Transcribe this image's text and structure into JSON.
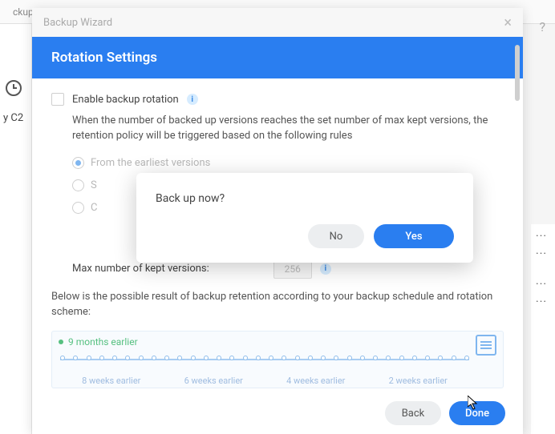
{
  "tabs": {
    "left": "ckup",
    "wizard": "Backup Wizard"
  },
  "help_glyph": "?",
  "left_label": "y C2",
  "wizard": {
    "close_glyph": "×",
    "title": "Rotation Settings",
    "enable_label": "Enable backup rotation",
    "desc": "When the number of backed up versions reaches the set number of max kept versions, the retention policy will be triggered based on the following rules",
    "radio1": "From the earliest versions",
    "radio2": "S",
    "radio3": "C",
    "max_label": "Max number of kept versions:",
    "max_value": "256",
    "below": "Below is the possible result of backup retention according to your backup schedule and rotation scheme:",
    "timeline": {
      "top": "9 months earlier",
      "b0": "8 weeks earlier",
      "b1": "6 weeks earlier",
      "b2": "4 weeks earlier",
      "b3": "2 weeks earlier"
    },
    "back": "Back",
    "done": "Done"
  },
  "modal": {
    "text": "Back up now?",
    "no": "No",
    "yes": "Yes"
  },
  "right_dots": "..."
}
